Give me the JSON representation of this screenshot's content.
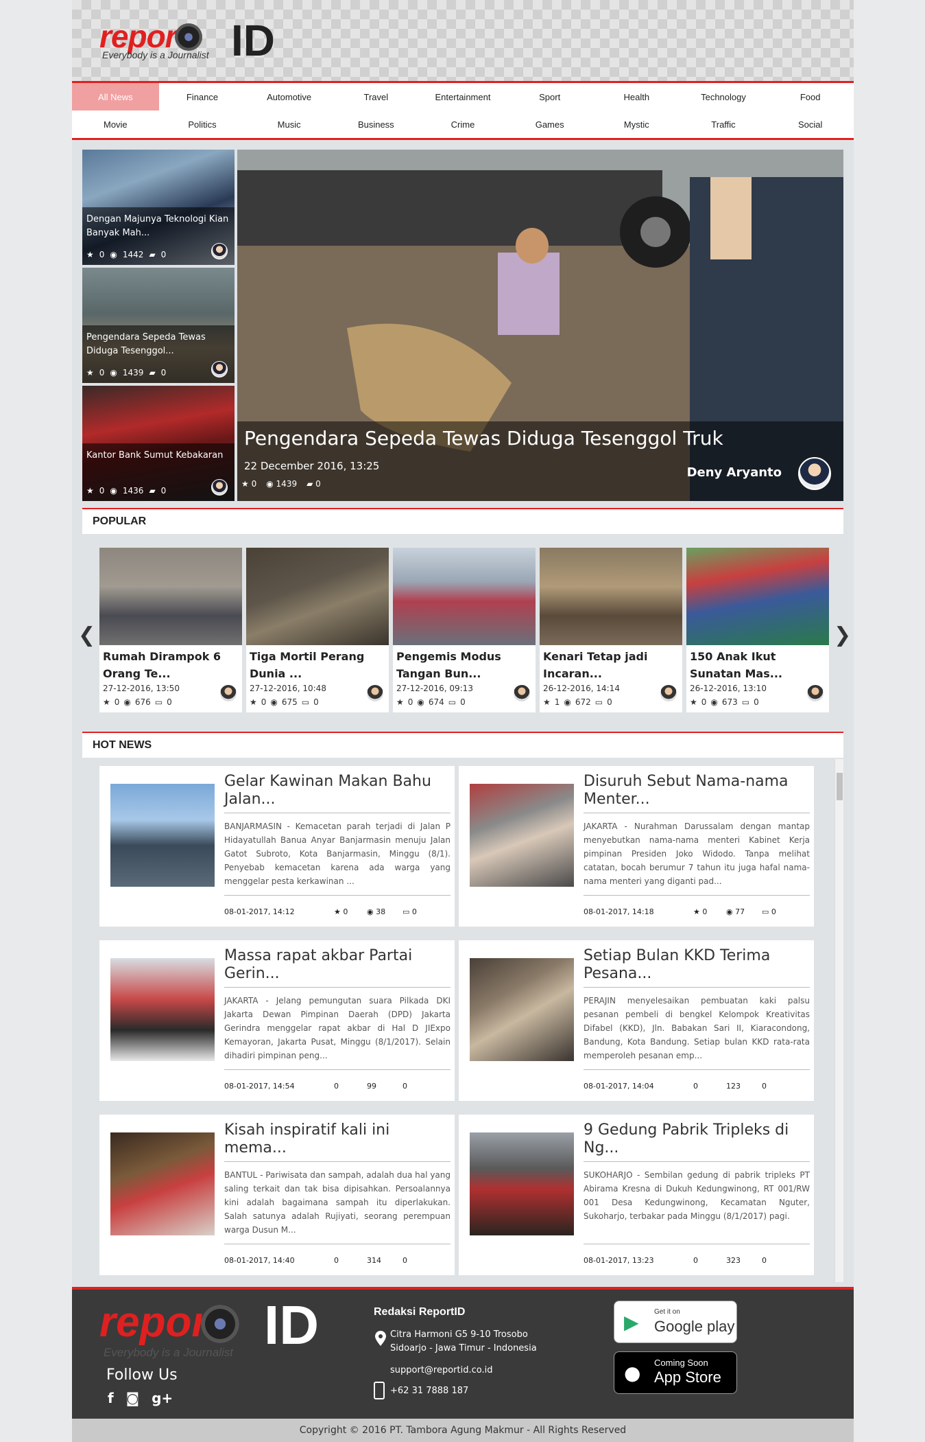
{
  "header": {
    "logo_word": "report",
    "logo_id": "ID",
    "tagline": "Everybody is a Journalist"
  },
  "nav": {
    "row1": [
      "All News",
      "Finance",
      "Automotive",
      "Travel",
      "Entertainment",
      "Sport",
      "Health",
      "Technology",
      "Food"
    ],
    "row2": [
      "Movie",
      "Politics",
      "Music",
      "Business",
      "Crime",
      "Games",
      "Mystic",
      "Traffic",
      "Social"
    ],
    "active": "All News"
  },
  "feature": {
    "side": [
      {
        "title": "Dengan Majunya Teknologi Kian Banyak Mah...",
        "stars": "0",
        "views": "1442",
        "comments": "0"
      },
      {
        "title": "Pengendara Sepeda Tewas Diduga Tesenggol...",
        "stars": "0",
        "views": "1439",
        "comments": "0"
      },
      {
        "title": "Kantor Bank Sumut Kebakaran",
        "stars": "0",
        "views": "1436",
        "comments": "0"
      }
    ],
    "main": {
      "title": "Pengendara Sepeda Tewas Diduga Tesenggol Truk",
      "date": "22 December 2016, 13:25",
      "stars": "0",
      "views": "1439",
      "comments": "0",
      "author": "Deny Aryanto"
    }
  },
  "popular": {
    "heading": "POPULAR",
    "items": [
      {
        "title": "Rumah Dirampok 6 Orang Te...",
        "date": "27-12-2016, 13:50",
        "stars": "0",
        "views": "676",
        "comments": "0"
      },
      {
        "title": "Tiga Mortil Perang Dunia ...",
        "date": "27-12-2016, 10:48",
        "stars": "0",
        "views": "675",
        "comments": "0"
      },
      {
        "title": "Pengemis Modus Tangan Bun...",
        "date": "27-12-2016, 09:13",
        "stars": "0",
        "views": "674",
        "comments": "0"
      },
      {
        "title": "Kenari Tetap jadi Incaran...",
        "date": "26-12-2016, 14:14",
        "stars": "1",
        "views": "672",
        "comments": "0"
      },
      {
        "title": "150 Anak Ikut Sunatan Mas...",
        "date": "26-12-2016, 13:10",
        "stars": "0",
        "views": "673",
        "comments": "0"
      }
    ]
  },
  "hot": {
    "heading": "HOT NEWS",
    "items": [
      {
        "title": "Gelar Kawinan Makan Bahu Jalan...",
        "body": "BANJARMASIN - Kemacetan parah terjadi di Jalan P Hidayatullah Banua Anyar Banjarmasin menuju Jalan Gatot Subroto, Kota Banjarmasin, Minggu (8/1). Penyebab kemacetan karena ada warga yang menggelar pesta kerkawinan ...",
        "date": "08-01-2017, 14:12",
        "stars": "0",
        "views": "38",
        "comments": "0"
      },
      {
        "title": "Disuruh Sebut Nama-nama Menter...",
        "body": "JAKARTA - Nurahman Darussalam dengan mantap menyebutkan nama-nama menteri Kabinet Kerja pimpinan Presiden Joko Widodo. Tanpa melihat catatan, bocah berumur 7 tahun itu juga hafal nama-nama menteri yang diganti pad...",
        "date": "08-01-2017, 14:18",
        "stars": "0",
        "views": "77",
        "comments": "0"
      },
      {
        "title": "Massa rapat akbar Partai Gerin...",
        "body": "JAKARTA - Jelang pemungutan suara Pilkada DKI Jakarta Dewan Pimpinan Daerah (DPD) Jakarta Gerindra menggelar rapat akbar di Hal D JIExpo Kemayoran, Jakarta Pusat, Minggu (8/1/2017). Selain dihadiri pimpinan peng...",
        "date": "08-01-2017, 14:54",
        "stars": "0",
        "views": "99",
        "comments": "0"
      },
      {
        "title": "Setiap Bulan KKD Terima Pesana...",
        "body": "PERAJIN menyelesaikan pembuatan kaki palsu pesanan pembeli di bengkel Kelompok Kreativitas Difabel (KKD), Jln. Babakan Sari II, Kiaracondong, Bandung, Kota Bandung. Setiap bulan KKD rata-rata memperoleh pesanan emp...",
        "date": "08-01-2017, 14:04",
        "stars": "0",
        "views": "123",
        "comments": "0"
      },
      {
        "title": "Kisah inspiratif kali ini mema...",
        "body": "BANTUL - Pariwisata dan sampah, adalah dua hal yang saling terkait dan tak bisa dipisahkan. Persoalannya kini adalah bagaimana sampah itu diperlakukan. Salah satunya adalah Rujiyati, seorang perempuan warga Dusun M...",
        "date": "08-01-2017, 14:40",
        "stars": "0",
        "views": "314",
        "comments": "0"
      },
      {
        "title": "9 Gedung Pabrik Tripleks di Ng...",
        "body": "SUKOHARJO - Sembilan gedung di pabrik tripleks PT Abirama Kresna di Dukuh Kedungwinong, RT 001/RW 001 Desa Kedungwinong, Kecamatan Nguter, Sukoharjo, terbakar pada Minggu (8/1/2017) pagi.",
        "date": "08-01-2017, 13:23",
        "stars": "0",
        "views": "323",
        "comments": "0"
      }
    ]
  },
  "footer": {
    "logo_word": "report",
    "logo_id": "ID",
    "tagline": "Everybody is a Journalist",
    "follow": "Follow Us",
    "social_icons": [
      "facebook-icon",
      "instagram-icon",
      "google-plus-icon"
    ],
    "redaksi": "Redaksi ReportID",
    "address1": "Citra Harmoni G5 9-10 Trosobo",
    "address2": "Sidoarjo - Jawa Timur - Indonesia",
    "email": "support@reportid.co.id",
    "phone": "+62 31 7888 187",
    "gplay_small": "Get it on",
    "gplay_big": "Google play",
    "astore_small": "Coming Soon",
    "astore_big": "App Store",
    "copyright": "Copyright © 2016 PT. Tambora Agung Makmur - All Rights Reserved"
  },
  "colors": {
    "accent": "#e02020",
    "active_nav": "#f0a0a0",
    "footer": "#3a3a3a"
  }
}
